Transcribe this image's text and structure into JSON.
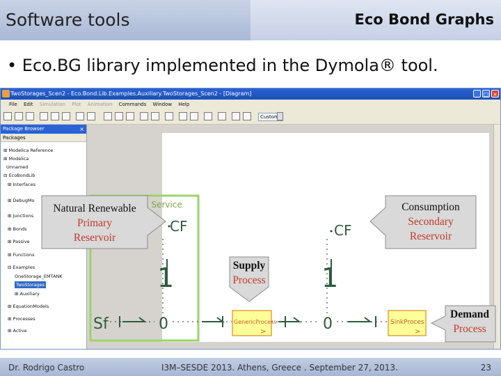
{
  "header": {
    "title": "Software tools",
    "subtitle": "Eco Bond Graphs"
  },
  "bullet": "• Eco.BG library implemented in the Dymola® tool.",
  "window": {
    "title": "TwoStorages_Scen2 - Eco.Bond.Lib.Examples.Auxiliary.TwoStorages_Scen2 - [Diagram]",
    "menu": [
      "File",
      "Edit",
      "Simulation",
      "Plot",
      "Animation",
      "Commands",
      "Window",
      "Help"
    ],
    "menu_dim": [
      "Simulation",
      "Plot",
      "Animation"
    ],
    "zoom_combo": "Custom",
    "package_browser": {
      "title": "Package Browser",
      "header": "Packages",
      "items": [
        "Modelica Reference",
        "Modelica",
        "Unnamed",
        "EcoBondLib",
        "Interfaces",
        "DebugMo",
        "Junctions",
        "Bonds",
        "Passive",
        "Functions",
        "Examples",
        "OneStorage_EMTANK",
        "TwoStorages",
        "Auxiliary",
        "EquationModels",
        "Processes",
        "Active"
      ],
      "selected": "TwoStorages"
    },
    "diagram": {
      "service_label": "al Service",
      "cf_label_1": "CF",
      "cf_label_2": "CF",
      "one_1": "1",
      "one_2": "1",
      "zero_1": "0",
      "zero_2": "0",
      "sf_label": "Sf",
      "generic_process": "GenericProcess",
      "sink_process": "SinkProces"
    }
  },
  "callouts": {
    "natural": [
      "Natural Renewable",
      "Primary",
      "Reservoir"
    ],
    "consumption": [
      "Consumption",
      "Secondary",
      "Reservoir"
    ],
    "supply": [
      "Supply",
      "Process"
    ],
    "demand": [
      "Demand",
      "Process"
    ]
  },
  "footer": {
    "author": "Dr. Rodrigo Castro",
    "event": "I3M–SESDE 2013. Athens, Greece . September 27, 2013.",
    "page": "23"
  },
  "colors": {
    "callout_fill": "#d9d9d9",
    "callout_border": "#8c8c8c",
    "highlight_green": "#9ed36a",
    "process_fill": "#ffff99",
    "process_border": "#e6a040",
    "selection_blue": "#316ac5"
  }
}
